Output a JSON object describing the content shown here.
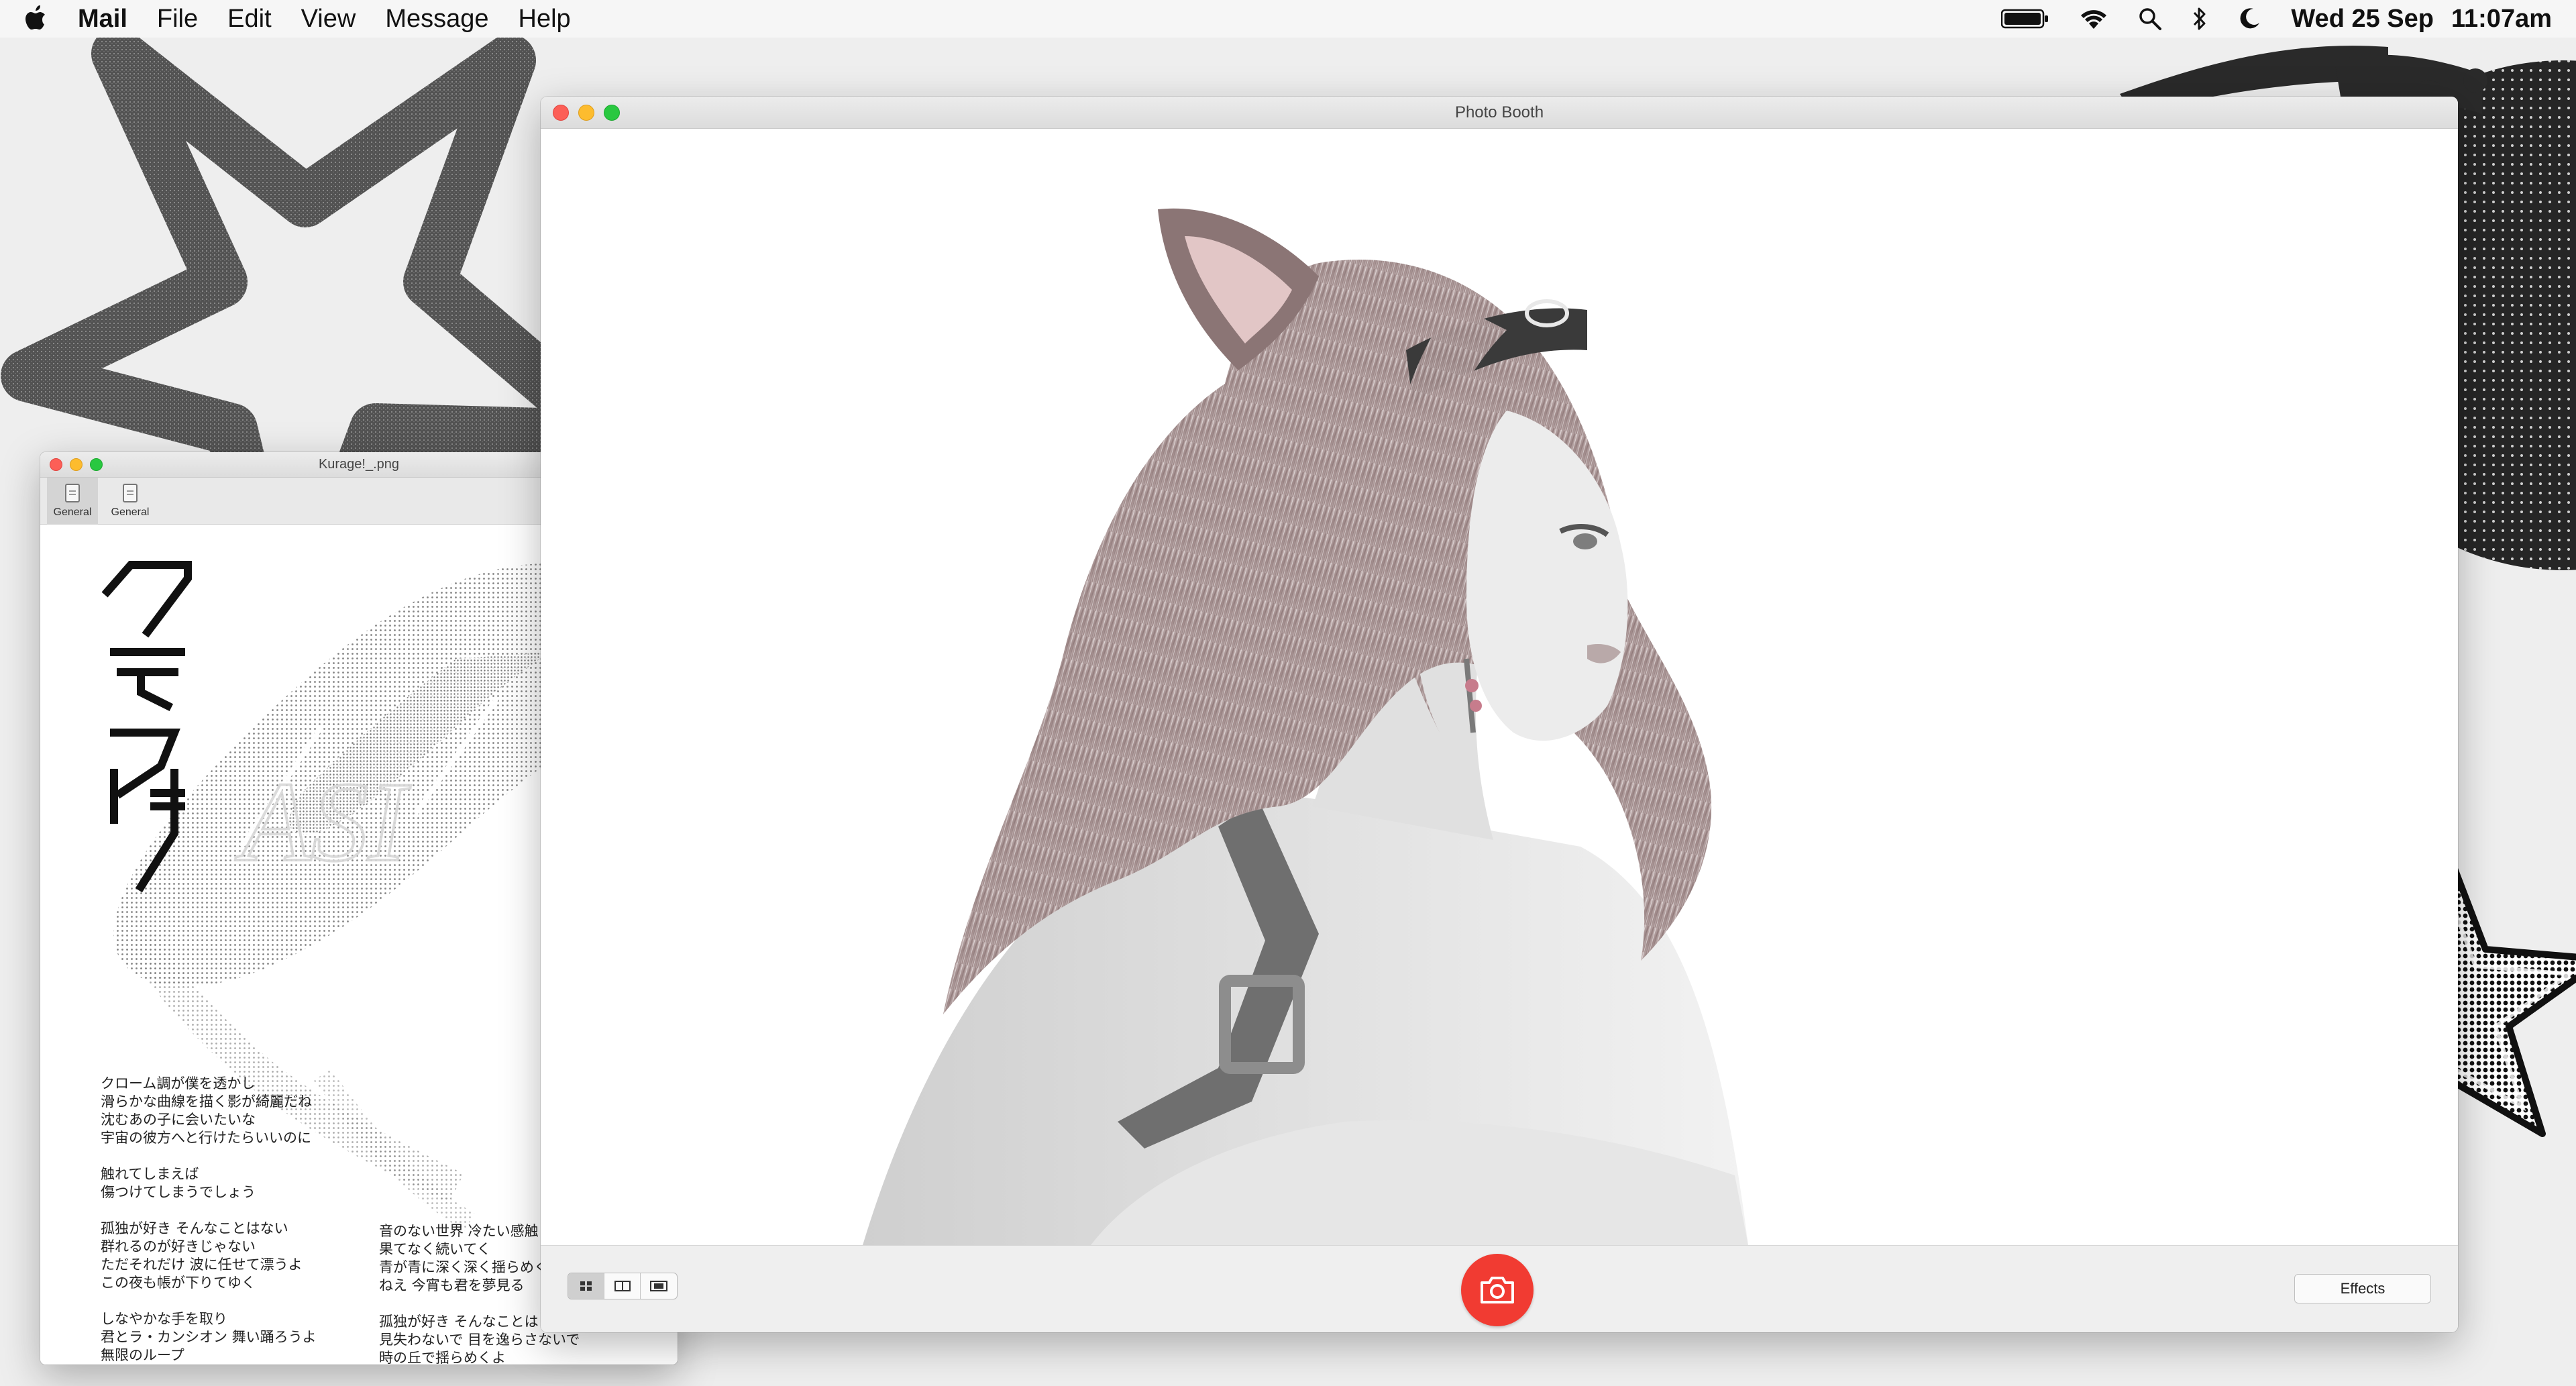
{
  "menubar": {
    "app": "Mail",
    "items": [
      "File",
      "Edit",
      "View",
      "Message",
      "Help"
    ],
    "date": "Wed 25 Sep",
    "time": "11:07am",
    "icons": [
      "battery-icon",
      "wifi-icon",
      "spotlight-icon",
      "bluetooth-icon",
      "do-not-disturb-icon"
    ]
  },
  "kurage_window": {
    "title": "Kurage!_.png",
    "tabs": [
      {
        "label": "General",
        "active": true
      },
      {
        "label": "General",
        "active": false
      }
    ],
    "lyrics_left": "クローム調が僕を透かし\n滑らかな曲線を描く影が綺麗だね\n沈むあの子に会いたいな\n宇宙の彼方へと行けたらいいのに\n\n触れてしまえば\n傷つけてしまうでしょう\n\n孤独が好き そんなことはない\n群れるのが好きじゃない\nただそれだけ 波に任せて漂うよ\nこの夜も帳が下りてゆく\n\nしなやかな手を取り\n君とラ・カンシオン 舞い踊ろうよ\n無限のループ\nいつか海に溶けて\n秘密に還るだけ",
    "lyrics_right": "音のない世界 冷たい感触\n果てなく続いてく\n青が青に深く深く揺らめく\nねえ 今宵も君を夢見る\n\n孤独が好き そんなことは\n見失わないで 目を逸らさないで\n時の丘で揺らめくよ\nほら 今宵は月が綺麗だね"
  },
  "photobooth_window": {
    "title": "Photo Booth",
    "view_modes": [
      "grid-view-icon",
      "split-view-icon",
      "filmstrip-view-icon"
    ],
    "active_view": 0,
    "shutter_icon": "camera-icon",
    "effects_label": "Effects"
  },
  "colors": {
    "shutter": "#f13b32",
    "close": "#fc5f57",
    "minimize": "#fdbc2e",
    "maximize": "#29c840"
  }
}
